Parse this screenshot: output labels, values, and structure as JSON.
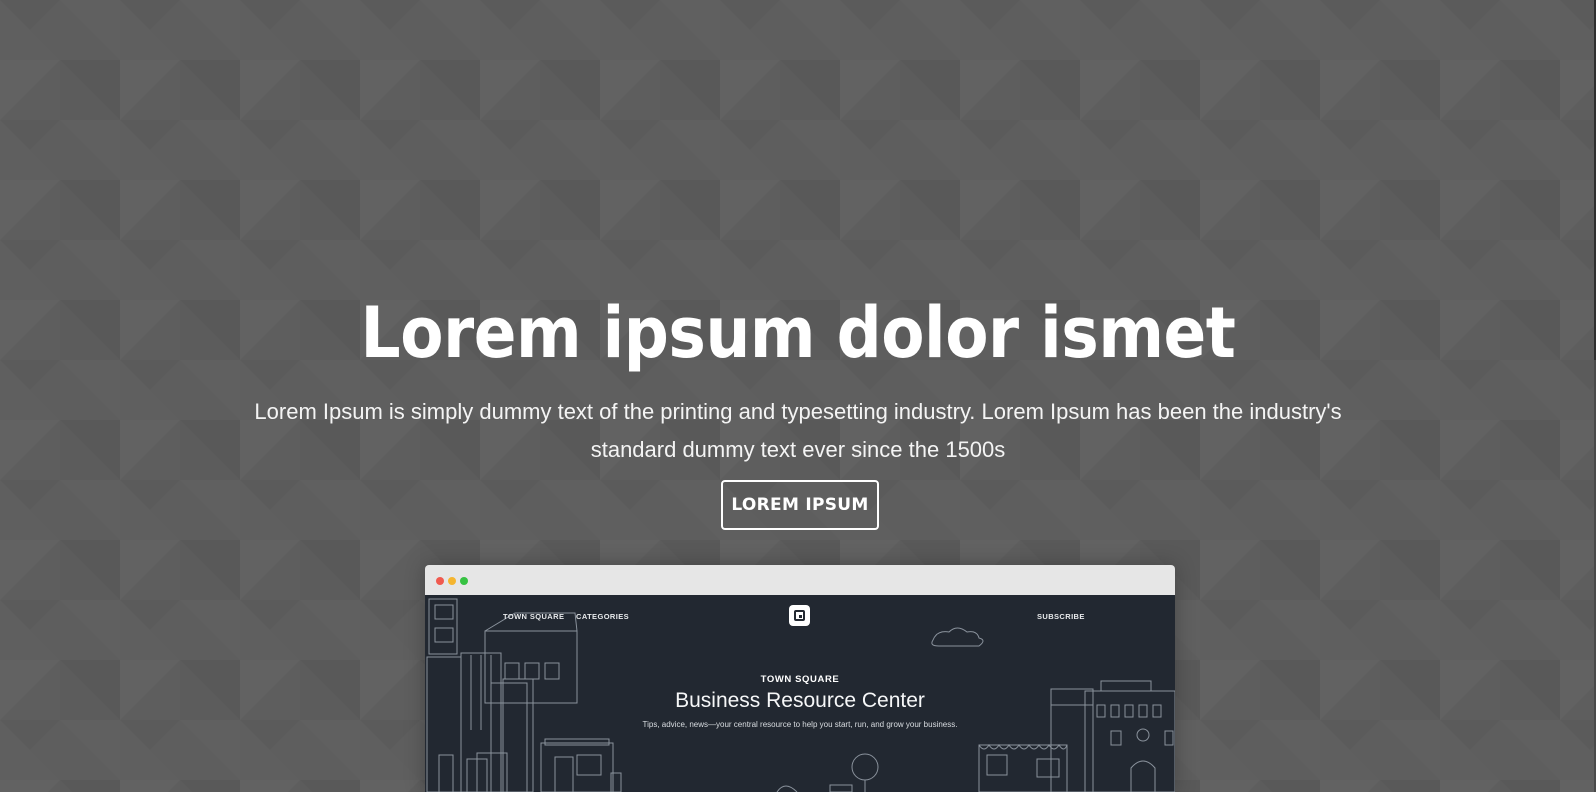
{
  "hero": {
    "title": "Lorem ipsum dolor ismet",
    "description": "Lorem Ipsum is simply dummy text of the printing and typesetting industry. Lorem Ipsum has been the industry's standard dummy text ever since the 1500s",
    "button_label": "LOREM IPSUM"
  },
  "mockup": {
    "nav": {
      "town_square": "TOWN SQUARE",
      "categories": "CATEGORIES",
      "subscribe": "SUBSCRIBE"
    },
    "kicker": "TOWN SQUARE",
    "title": "Business Resource Center",
    "subtitle": "Tips, advice, news—your central resource to help you start, run, and grow your business.",
    "logo_icon": "square-logo-icon",
    "window_dots": [
      "#f05a4f",
      "#f5b52f",
      "#36c242"
    ]
  },
  "colors": {
    "background": "#5e5e5e",
    "screen": "#222831",
    "text": "#ffffff"
  }
}
